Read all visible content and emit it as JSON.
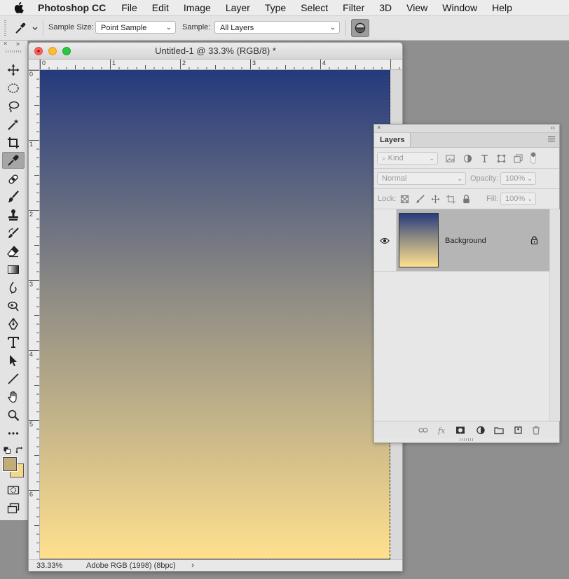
{
  "menubar": {
    "app_name": "Photoshop CC",
    "items": [
      "File",
      "Edit",
      "Image",
      "Layer",
      "Type",
      "Select",
      "Filter",
      "3D",
      "View",
      "Window",
      "Help"
    ]
  },
  "options_bar": {
    "sample_size_label": "Sample Size:",
    "sample_size_value": "Point Sample",
    "sample_label": "Sample:",
    "sample_value": "All Layers"
  },
  "tools": [
    {
      "name": "move-tool",
      "icon": "move-icon"
    },
    {
      "name": "marquee-tool",
      "icon": "elliptical-marquee-icon"
    },
    {
      "name": "lasso-tool",
      "icon": "lasso-icon"
    },
    {
      "name": "magic-wand-tool",
      "icon": "magic-wand-icon"
    },
    {
      "name": "crop-tool",
      "icon": "crop-icon"
    },
    {
      "name": "eyedropper-tool",
      "icon": "eyedropper-icon",
      "active": true
    },
    {
      "name": "healing-brush-tool",
      "icon": "bandage-icon"
    },
    {
      "name": "brush-tool",
      "icon": "brush-icon"
    },
    {
      "name": "clone-stamp-tool",
      "icon": "stamp-icon"
    },
    {
      "name": "history-brush-tool",
      "icon": "history-brush-icon"
    },
    {
      "name": "eraser-tool",
      "icon": "eraser-icon"
    },
    {
      "name": "gradient-tool",
      "icon": "gradient-icon"
    },
    {
      "name": "blur-tool",
      "icon": "blur-drop-icon"
    },
    {
      "name": "dodge-tool",
      "icon": "dodge-icon"
    },
    {
      "name": "pen-tool",
      "icon": "pen-icon"
    },
    {
      "name": "type-tool",
      "icon": "type-icon"
    },
    {
      "name": "path-selection-tool",
      "icon": "arrow-icon"
    },
    {
      "name": "line-tool",
      "icon": "line-icon"
    },
    {
      "name": "hand-tool",
      "icon": "hand-icon"
    },
    {
      "name": "zoom-tool",
      "icon": "zoom-icon"
    },
    {
      "name": "more-tools",
      "icon": "ellipsis-icon"
    }
  ],
  "colors": {
    "foreground": "#c1ac7c",
    "background": "#f5d98a",
    "gradient_top": "#253a7c",
    "gradient_mid": "#8c8a84",
    "gradient_bottom": "#ffe08e"
  },
  "document": {
    "title": "Untitled-1 @ 33.3% (RGB/8) *",
    "zoom": "33.33%",
    "profile": "Adobe RGB (1998) (8bpc)",
    "ruler_top": [
      "0",
      "1",
      "2",
      "3",
      "4"
    ],
    "ruler_left": [
      "0",
      "1",
      "2",
      "3",
      "4",
      "5",
      "6"
    ]
  },
  "layers_panel": {
    "tab": "Layers",
    "filter_kind": "Kind",
    "blend_mode": "Normal",
    "opacity_label": "Opacity:",
    "opacity_value": "100%",
    "lock_label": "Lock:",
    "fill_label": "Fill:",
    "fill_value": "100%",
    "layers": [
      {
        "name": "Background",
        "visible": true,
        "locked": true
      }
    ]
  }
}
